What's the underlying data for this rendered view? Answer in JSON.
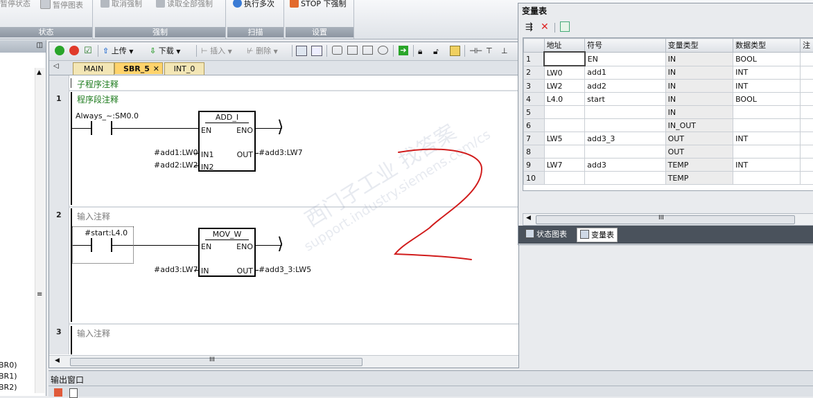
{
  "ribbon": {
    "groups": [
      {
        "label": "状态",
        "buttons": [
          "暂停状态",
          "暂停图表"
        ]
      },
      {
        "label": "强制",
        "buttons": [
          "取消强制",
          "读取全部强制"
        ]
      },
      {
        "label": "扫描",
        "buttons": [
          "执行多次"
        ]
      },
      {
        "label": "设置",
        "buttons": [
          "STOP 下强制"
        ]
      }
    ]
  },
  "left_panel": {
    "items": [
      "BR0)",
      "BR1)",
      "BR2)"
    ]
  },
  "editor": {
    "toolbar": {
      "upload": "上传",
      "download": "下载",
      "insert": "插入",
      "delete": "删除"
    },
    "tabs": [
      "MAIN",
      "SBR_5",
      "INT_0"
    ],
    "sub_comment": "子程序注释",
    "networks": [
      {
        "num": "1",
        "comment": "程序段注释",
        "contact_label": "Always_~:SM0.0",
        "box_title": "ADD_I",
        "en": "EN",
        "eno": "ENO",
        "in1_label": "#add1:LW0",
        "in1": "IN1",
        "in2_label": "#add2:LW2",
        "in2": "IN2",
        "out": "OUT",
        "out_label": "#add3:LW7"
      },
      {
        "num": "2",
        "comment": "输入注释",
        "contact_label": "#start:L4.0",
        "box_title": "MOV_W",
        "en": "EN",
        "eno": "ENO",
        "in_label": "#add3:LW7",
        "in": "IN",
        "out": "OUT",
        "out_label": "#add3_3:LW5"
      },
      {
        "num": "3",
        "comment": "输入注释"
      }
    ],
    "scroll_marker": "III"
  },
  "output_window": {
    "title": "输出窗口"
  },
  "var_table": {
    "title": "变量表",
    "headers": [
      "",
      "地址",
      "符号",
      "变量类型",
      "数据类型",
      "注"
    ],
    "rows": [
      [
        "1",
        "",
        "EN",
        "IN",
        "BOOL"
      ],
      [
        "2",
        "LW0",
        "add1",
        "IN",
        "INT"
      ],
      [
        "3",
        "LW2",
        "add2",
        "IN",
        "INT"
      ],
      [
        "4",
        "L4.0",
        "start",
        "IN",
        "BOOL"
      ],
      [
        "5",
        "",
        "",
        "IN",
        ""
      ],
      [
        "6",
        "",
        "",
        "IN_OUT",
        ""
      ],
      [
        "7",
        "LW5",
        "add3_3",
        "OUT",
        "INT"
      ],
      [
        "8",
        "",
        "",
        "OUT",
        ""
      ],
      [
        "9",
        "LW7",
        "add3",
        "TEMP",
        "INT"
      ],
      [
        "10",
        "",
        "",
        "TEMP",
        ""
      ]
    ],
    "scroll_marker": "III",
    "tabs": [
      "状态图表",
      "变量表"
    ]
  },
  "watermark": {
    "line1": "西门子工业  找答案",
    "line2": "support.industry.siemens.com/cs"
  },
  "colors": {
    "accent_tab": "#ffd36b",
    "comment_green": "#1b7a1b",
    "annotation_red": "#d11c1c"
  }
}
